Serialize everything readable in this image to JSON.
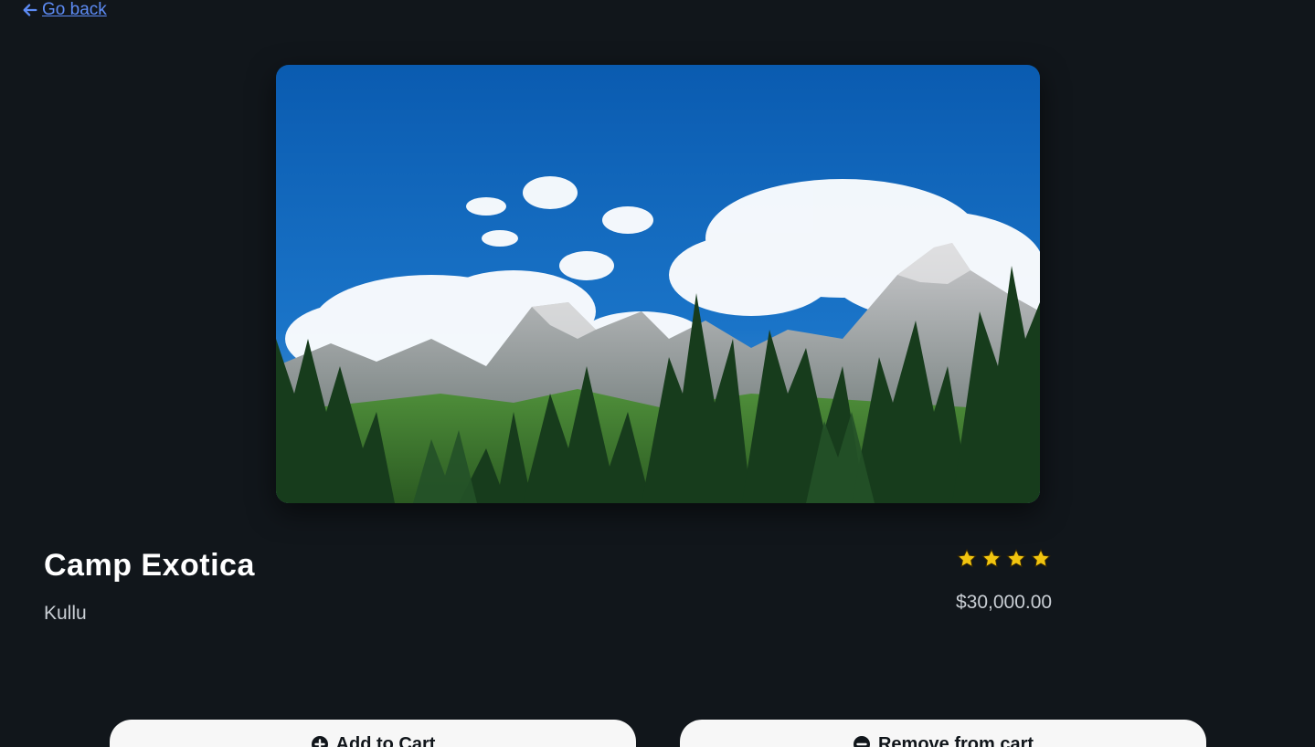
{
  "nav": {
    "back_label": "Go back"
  },
  "listing": {
    "title": "Camp Exotica",
    "location": "Kullu",
    "price": "$30,000.00",
    "rating": 4
  },
  "actions": {
    "add_label": "Add to Cart",
    "remove_label": "Remove from cart"
  }
}
